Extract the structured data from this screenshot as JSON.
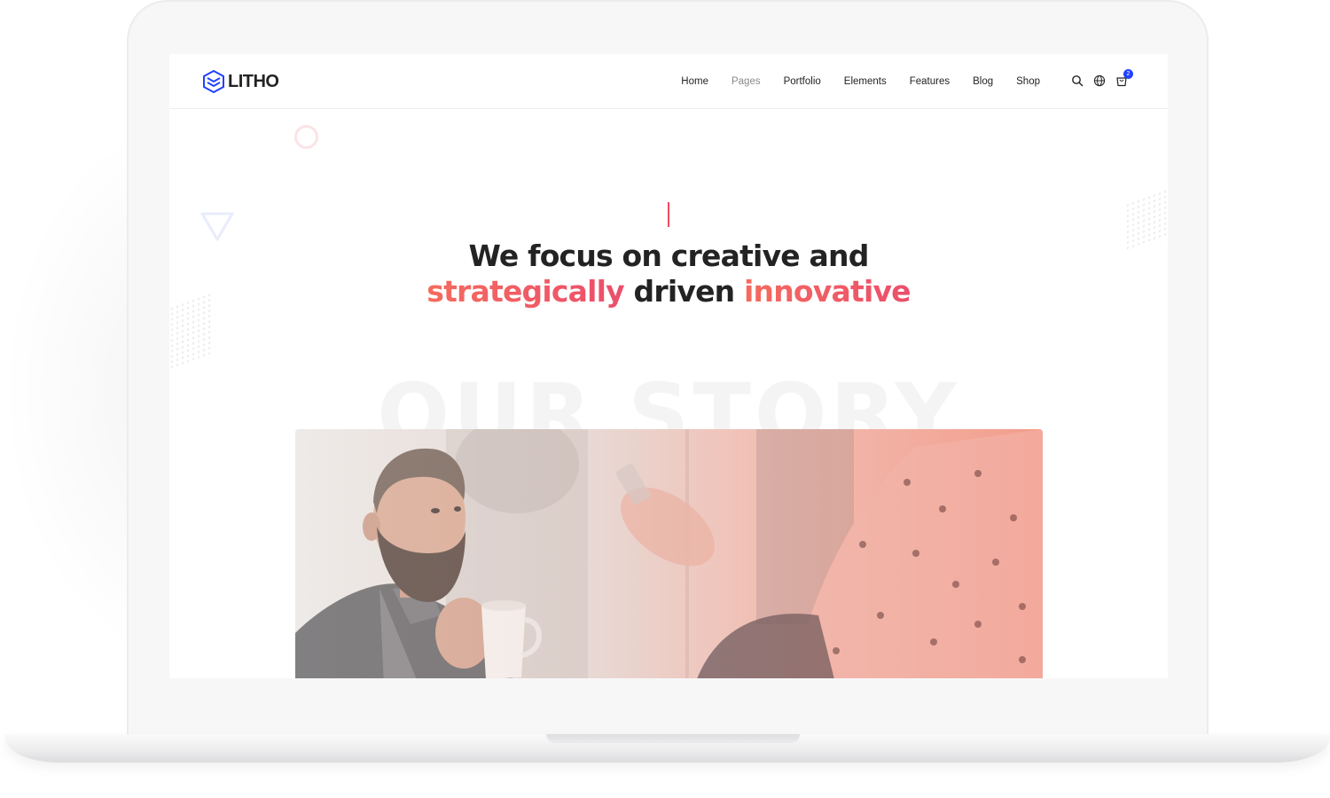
{
  "brand": {
    "name": "LITHO",
    "accent": "#2341ff"
  },
  "nav": {
    "items": [
      {
        "label": "Home"
      },
      {
        "label": "Pages"
      },
      {
        "label": "Portfolio"
      },
      {
        "label": "Elements"
      },
      {
        "label": "Features"
      },
      {
        "label": "Blog"
      },
      {
        "label": "Shop"
      }
    ],
    "active": "Pages"
  },
  "header_icons": {
    "search": "search-icon",
    "language": "globe-icon",
    "cart": "cart-icon",
    "cart_count": "2"
  },
  "hero": {
    "line1": "We focus on creative and",
    "word_a": "strategically",
    "word_mid": " driven ",
    "word_b": "innovative",
    "gradient_colors": [
      "#f56b5e",
      "#ec4e6c"
    ],
    "background_word": "OUR STORY"
  },
  "photo": {
    "alt": "Bearded man holding a white coffee cup in a meeting"
  }
}
